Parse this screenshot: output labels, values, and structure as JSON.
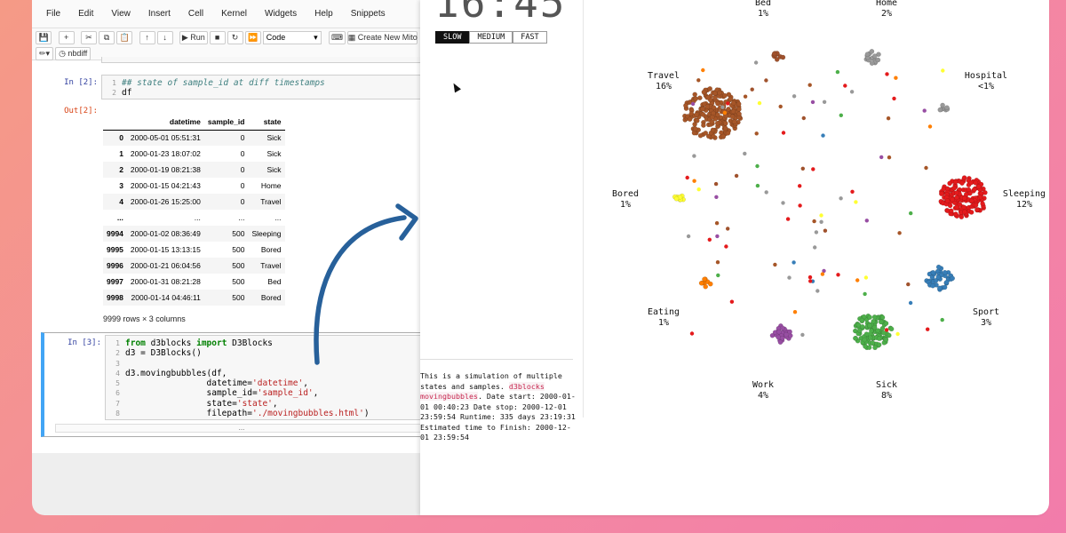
{
  "jupyter": {
    "menu": [
      "File",
      "Edit",
      "View",
      "Insert",
      "Cell",
      "Kernel",
      "Widgets",
      "Help",
      "Snippets"
    ],
    "toolbar": {
      "run_label": "Run",
      "cell_type": "Code",
      "mito_label": "Create New Mito",
      "nbdiff_label": "nbdiff"
    },
    "cell2": {
      "prompt_in": "In [2]:",
      "prompt_out": "Out[2]:",
      "line1": "## state of sample_id at diff timestamps",
      "line2": "df"
    },
    "df": {
      "columns": [
        "datetime",
        "sample_id",
        "state"
      ],
      "rows": [
        {
          "idx": "0",
          "datetime": "2000-05-01 05:51:31",
          "sample_id": "0",
          "state": "Sick"
        },
        {
          "idx": "1",
          "datetime": "2000-01-23 18:07:02",
          "sample_id": "0",
          "state": "Sick"
        },
        {
          "idx": "2",
          "datetime": "2000-01-19 08:21:38",
          "sample_id": "0",
          "state": "Sick"
        },
        {
          "idx": "3",
          "datetime": "2000-01-15 04:21:43",
          "sample_id": "0",
          "state": "Home"
        },
        {
          "idx": "4",
          "datetime": "2000-01-26 15:25:00",
          "sample_id": "0",
          "state": "Travel"
        },
        {
          "idx": "...",
          "datetime": "...",
          "sample_id": "...",
          "state": "..."
        },
        {
          "idx": "9994",
          "datetime": "2000-01-02 08:36:49",
          "sample_id": "500",
          "state": "Sleeping"
        },
        {
          "idx": "9995",
          "datetime": "2000-01-15 13:13:15",
          "sample_id": "500",
          "state": "Bored"
        },
        {
          "idx": "9996",
          "datetime": "2000-01-21 06:04:56",
          "sample_id": "500",
          "state": "Travel"
        },
        {
          "idx": "9997",
          "datetime": "2000-01-31 08:21:28",
          "sample_id": "500",
          "state": "Bed"
        },
        {
          "idx": "9998",
          "datetime": "2000-01-14 04:46:11",
          "sample_id": "500",
          "state": "Bored"
        }
      ],
      "shape_text": "9999 rows × 3 columns"
    },
    "cell3": {
      "prompt_in": "In [3]:",
      "kw_from": "from",
      "mod": " d3blocks ",
      "kw_import": "import",
      "cls": " D3Blocks",
      "line2": "d3 = D3Blocks()",
      "line3": "",
      "line4": "d3.movingbubbles(df,",
      "l5a": "                datetime=",
      "l5b": "'datetime'",
      "l5c": ",",
      "l6a": "                sample_id=",
      "l6b": "'sample_id'",
      "l6c": ",",
      "l7a": "                state=",
      "l7b": "'state'",
      "l7c": ",",
      "l8a": "                filepath=",
      "l8b": "'./movingbubbles.html'",
      "l8c": ")",
      "ellipsis": "..."
    }
  },
  "d3": {
    "clock": "16:45",
    "speeds": [
      "SLOW",
      "MEDIUM",
      "FAST"
    ],
    "active_speed": "SLOW",
    "description_a": "This is a simulation of multiple states and samples. ",
    "description_lib": "d3blocks movingbubbles",
    "description_b": ". Date start: 2000-01-01 00:40:23 Date stop: 2000-12-01 23:59:54 Runtime: 335 days 23:19:31 Estimated time to Finish: 2000-12-01 23:59:54",
    "states": [
      {
        "name": "Bed",
        "pct": "1%",
        "color": "#a0522d"
      },
      {
        "name": "Home",
        "pct": "2%",
        "color": "#999999"
      },
      {
        "name": "Hospital",
        "pct": "<1%",
        "color": "#999999"
      },
      {
        "name": "Sleeping",
        "pct": "12%",
        "color": "#e41a1c"
      },
      {
        "name": "Sport",
        "pct": "3%",
        "color": "#377eb8"
      },
      {
        "name": "Sick",
        "pct": "8%",
        "color": "#4daf4a"
      },
      {
        "name": "Work",
        "pct": "4%",
        "color": "#984ea3"
      },
      {
        "name": "Eating",
        "pct": "1%",
        "color": "#ff7f00"
      },
      {
        "name": "Bored",
        "pct": "1%",
        "color": "#ffff33"
      },
      {
        "name": "Travel",
        "pct": "16%",
        "color": "#a65628"
      }
    ]
  }
}
